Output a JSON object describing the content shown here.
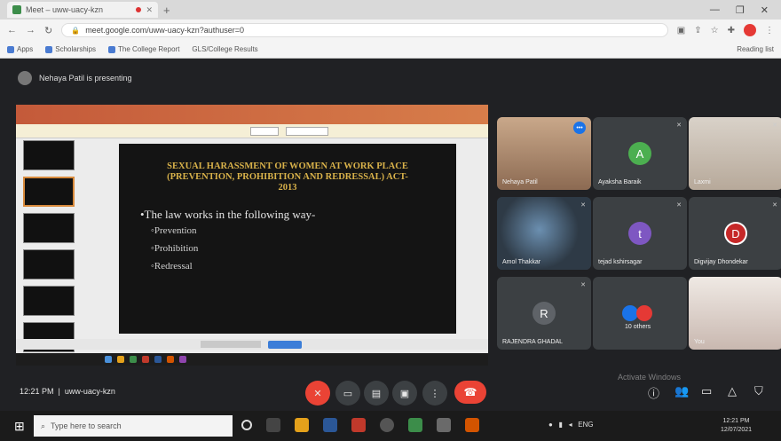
{
  "browser": {
    "tab_title": "Meet – uww-uacy-kzn",
    "url": "meet.google.com/uww-uacy-kzn?authuser=0",
    "bookmarks": [
      "Apps",
      "Scholarships",
      "The College Report",
      "GLS/College Results"
    ],
    "reading_list": "Reading list"
  },
  "meet": {
    "presenting_text": "Nehaya Patil is presenting",
    "clock": "12:21 PM",
    "meeting_code": "uww-uacy-kzn",
    "watermark": "Activate Windows"
  },
  "slide": {
    "title_line1": "Sexual Harassment of Women at Work Place",
    "title_line2": "(Prevention, Prohibition and Redressal) Act-",
    "title_line3": "2013",
    "bullet": "•The law works in the following way-",
    "sub_items": [
      "◦Prevention",
      "◦Prohibition",
      "◦Redressal"
    ]
  },
  "participants": [
    {
      "name": "Nehaya Patil",
      "type": "video",
      "badge": "•••"
    },
    {
      "name": "Ayaksha Baraik",
      "type": "avatar",
      "initial": "A",
      "color": "#4caf50"
    },
    {
      "name": "Laxmi",
      "type": "video"
    },
    {
      "name": "Amol Thakkar",
      "type": "video"
    },
    {
      "name": "tejad kshirsagar",
      "type": "avatar",
      "initial": "t",
      "color": "#7e57c2"
    },
    {
      "name": "Digvijay Dhondekar",
      "type": "avatar",
      "initial": "D",
      "color": "#c62828"
    },
    {
      "name": "RAJENDRA GHADAL",
      "type": "avatar",
      "initial": "R",
      "color": "#5f6368"
    },
    {
      "name": "10 others",
      "type": "group"
    },
    {
      "name": "You",
      "type": "video"
    }
  ],
  "taskbar": {
    "search_placeholder": "Type here to search",
    "tray_text": "ENG",
    "time": "12:21 PM",
    "date": "12/07/2021"
  },
  "colors": {
    "meet_bg": "#202124",
    "tile_bg": "#3c4043",
    "hangup": "#ea4335",
    "slide_title": "#d9b24a"
  }
}
